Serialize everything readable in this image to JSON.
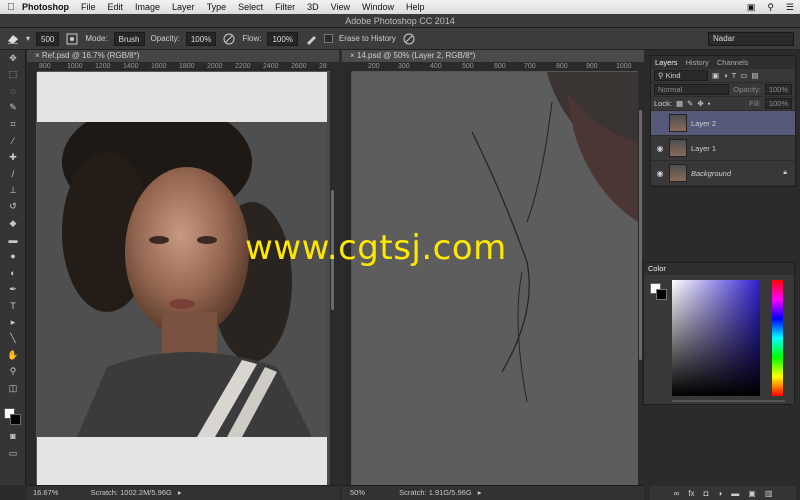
{
  "menubar": {
    "app_name": "Photoshop",
    "items": [
      "File",
      "Edit",
      "Image",
      "Layer",
      "Type",
      "Select",
      "Filter",
      "3D",
      "View",
      "Window",
      "Help"
    ]
  },
  "window": {
    "title": "Adobe Photoshop CC 2014"
  },
  "options": {
    "brush_size": "500",
    "mode_label": "Mode:",
    "mode_value": "Brush",
    "opacity_label": "Opacity:",
    "opacity_value": "100%",
    "flow_label": "Flow:",
    "flow_value": "100%",
    "erase_history_label": "Erase to History",
    "preset_value": "Nadar"
  },
  "documents": [
    {
      "tab_title": "Ref.psd @ 16.7% (RGB/8*)",
      "ruler_ticks": [
        "800",
        "1000",
        "1200",
        "1400",
        "1600",
        "1800",
        "2000",
        "2200",
        "2400",
        "2600",
        "28"
      ],
      "zoom": "16.67%",
      "scratch": "Scratch: 1002.2M/5.96G"
    },
    {
      "tab_title": "14.psd @ 50% (Layer 2, RGB/8*)",
      "ruler_ticks": [
        "200",
        "300",
        "400",
        "500",
        "600",
        "700",
        "800",
        "900",
        "1000"
      ],
      "zoom": "50%",
      "scratch": "Scratch: 1.91G/5.96G"
    }
  ],
  "layers_panel": {
    "tabs": [
      "Layers",
      "History",
      "Channels"
    ],
    "filter_label": "Kind",
    "blend_mode": "Normal",
    "opacity_label": "Opacity:",
    "opacity_value": "100%",
    "lock_label": "Lock:",
    "fill_label": "Fill:",
    "fill_value": "100%",
    "layers": [
      {
        "name": "Layer 2",
        "visible": false,
        "selected": true
      },
      {
        "name": "Layer 1",
        "visible": true,
        "selected": false
      },
      {
        "name": "Background",
        "visible": true,
        "selected": false,
        "locked": true
      }
    ]
  },
  "color_panel": {
    "title": "Color",
    "accent": "#2f1fd0"
  },
  "watermark": "www.cgtsj.com"
}
